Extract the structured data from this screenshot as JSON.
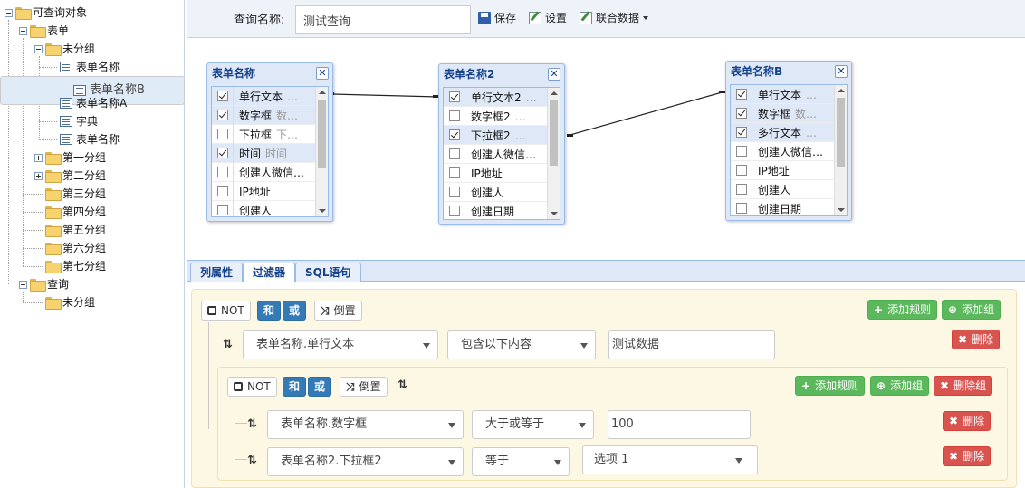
{
  "tree": {
    "root": "可查询对象",
    "forms_group": "表单",
    "ungrouped": "未分组",
    "forms": [
      "表单名称",
      "表单名称B",
      "表单名称A",
      "字典",
      "表单名称"
    ],
    "groups": [
      "第一分组",
      "第二分组",
      "第三分组",
      "第四分组",
      "第五分组",
      "第六分组",
      "第七分组"
    ],
    "queries_group": "查询",
    "queries_ungrouped": "未分组"
  },
  "toolbar": {
    "query_label": "查询名称:",
    "query_value": "测试查询",
    "save": "保存",
    "settings": "设置",
    "join_data": "联合数据"
  },
  "tables": [
    {
      "title": "表单名称",
      "rows": [
        {
          "name": "单行文本",
          "alias": "…",
          "checked": true
        },
        {
          "name": "数字框",
          "alias": "数…",
          "checked": true
        },
        {
          "name": "下拉框",
          "alias": "下…",
          "checked": false
        },
        {
          "name": "时间",
          "alias": "时间",
          "checked": true
        },
        {
          "name": "创建人微信…",
          "alias": "",
          "checked": false
        },
        {
          "name": "IP地址",
          "alias": "",
          "checked": false
        },
        {
          "name": "创建人",
          "alias": "",
          "checked": false
        }
      ]
    },
    {
      "title": "表单名称2",
      "rows": [
        {
          "name": "单行文本2",
          "alias": "…",
          "checked": true
        },
        {
          "name": "数字框2",
          "alias": "…",
          "checked": false
        },
        {
          "name": "下拉框2",
          "alias": "…",
          "checked": true
        },
        {
          "name": "创建人微信…",
          "alias": "",
          "checked": false
        },
        {
          "name": "IP地址",
          "alias": "",
          "checked": false
        },
        {
          "name": "创建人",
          "alias": "",
          "checked": false
        },
        {
          "name": "创建日期",
          "alias": "",
          "checked": false
        }
      ]
    },
    {
      "title": "表单名称B",
      "rows": [
        {
          "name": "单行文本",
          "alias": "…",
          "checked": true
        },
        {
          "name": "数字框",
          "alias": "数…",
          "checked": true
        },
        {
          "name": "多行文本",
          "alias": "…",
          "checked": true
        },
        {
          "name": "创建人微信…",
          "alias": "",
          "checked": false
        },
        {
          "name": "IP地址",
          "alias": "",
          "checked": false
        },
        {
          "name": "创建人",
          "alias": "",
          "checked": false
        },
        {
          "name": "创建日期",
          "alias": "",
          "checked": false
        }
      ]
    }
  ],
  "tabs": [
    "列属性",
    "过滤器",
    "SQL语句"
  ],
  "filter": {
    "not": "NOT",
    "and": "和",
    "or": "或",
    "invert": "倒置",
    "add_rule": "添加规则",
    "add_group": "添加组",
    "delete": "删除",
    "delete_group": "删除组",
    "rule1": {
      "field": "表单名称.单行文本",
      "op": "包含以下内容",
      "value": "测试数据"
    },
    "rule2": {
      "field": "表单名称.数字框",
      "op": "大于或等于",
      "value": "100"
    },
    "rule3": {
      "field": "表单名称2.下拉框2",
      "op": "等于",
      "value": "选项 1"
    }
  }
}
